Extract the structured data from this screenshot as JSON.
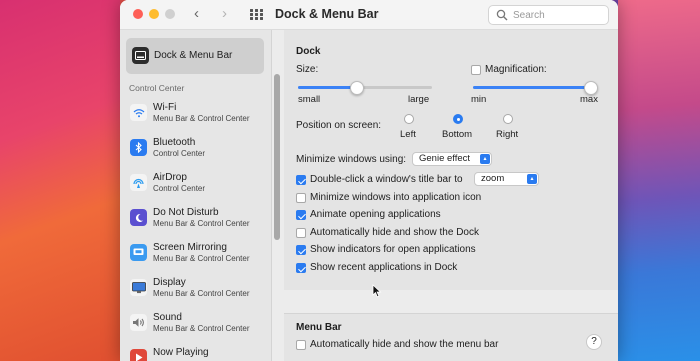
{
  "window": {
    "title": "Dock & Menu Bar",
    "search_placeholder": "Search"
  },
  "sidebar": {
    "selected": {
      "label": "Dock & Menu Bar",
      "icon": "dock-icon"
    },
    "section_header": "Control Center",
    "items": [
      {
        "label": "Wi-Fi",
        "sub": "Menu Bar & Control Center",
        "icon": "wifi-icon",
        "color": "#2a7bf0"
      },
      {
        "label": "Bluetooth",
        "sub": "Control Center",
        "icon": "bluetooth-icon",
        "color": "#2a7bf0"
      },
      {
        "label": "AirDrop",
        "sub": "Control Center",
        "icon": "airdrop-icon",
        "color": "#2a9bf0"
      },
      {
        "label": "Do Not Disturb",
        "sub": "Menu Bar & Control Center",
        "icon": "moon-icon",
        "color": "#5a4fd0"
      },
      {
        "label": "Screen Mirroring",
        "sub": "Menu Bar & Control Center",
        "icon": "screen-mirroring-icon",
        "color": "#3a9af0"
      },
      {
        "label": "Display",
        "sub": "Menu Bar & Control Center",
        "icon": "display-icon",
        "color": "#3a7ad8"
      },
      {
        "label": "Sound",
        "sub": "Menu Bar & Control Center",
        "icon": "speaker-icon",
        "color": "#888888"
      },
      {
        "label": "Now Playing",
        "sub": "",
        "icon": "play-icon",
        "color": "#e0483a"
      }
    ]
  },
  "dock": {
    "heading": "Dock",
    "size_label": "Size:",
    "size_min": "small",
    "size_max": "large",
    "size_value": 0.44,
    "magnification_label": "Magnification:",
    "magnification_checked": false,
    "mag_min": "min",
    "mag_max": "max",
    "mag_value": 0.97,
    "position_label": "Position on screen:",
    "positions": [
      {
        "label": "Left",
        "selected": false
      },
      {
        "label": "Bottom",
        "selected": true
      },
      {
        "label": "Right",
        "selected": false
      }
    ],
    "minimize_label": "Minimize windows using:",
    "minimize_value": "Genie effect",
    "options": [
      {
        "label": "Double-click a window's title bar to",
        "checked": true
      },
      {
        "label": "Minimize windows into application icon",
        "checked": false
      },
      {
        "label": "Animate opening applications",
        "checked": true
      },
      {
        "label": "Automatically hide and show the Dock",
        "checked": false
      },
      {
        "label": "Show indicators for open applications",
        "checked": true
      },
      {
        "label": "Show recent applications in Dock",
        "checked": true
      }
    ],
    "double_click_value": "zoom"
  },
  "menubar": {
    "heading": "Menu Bar",
    "option": {
      "label": "Automatically hide and show the menu bar",
      "checked": false
    }
  },
  "help_label": "?",
  "accent": "#2a7bf0"
}
